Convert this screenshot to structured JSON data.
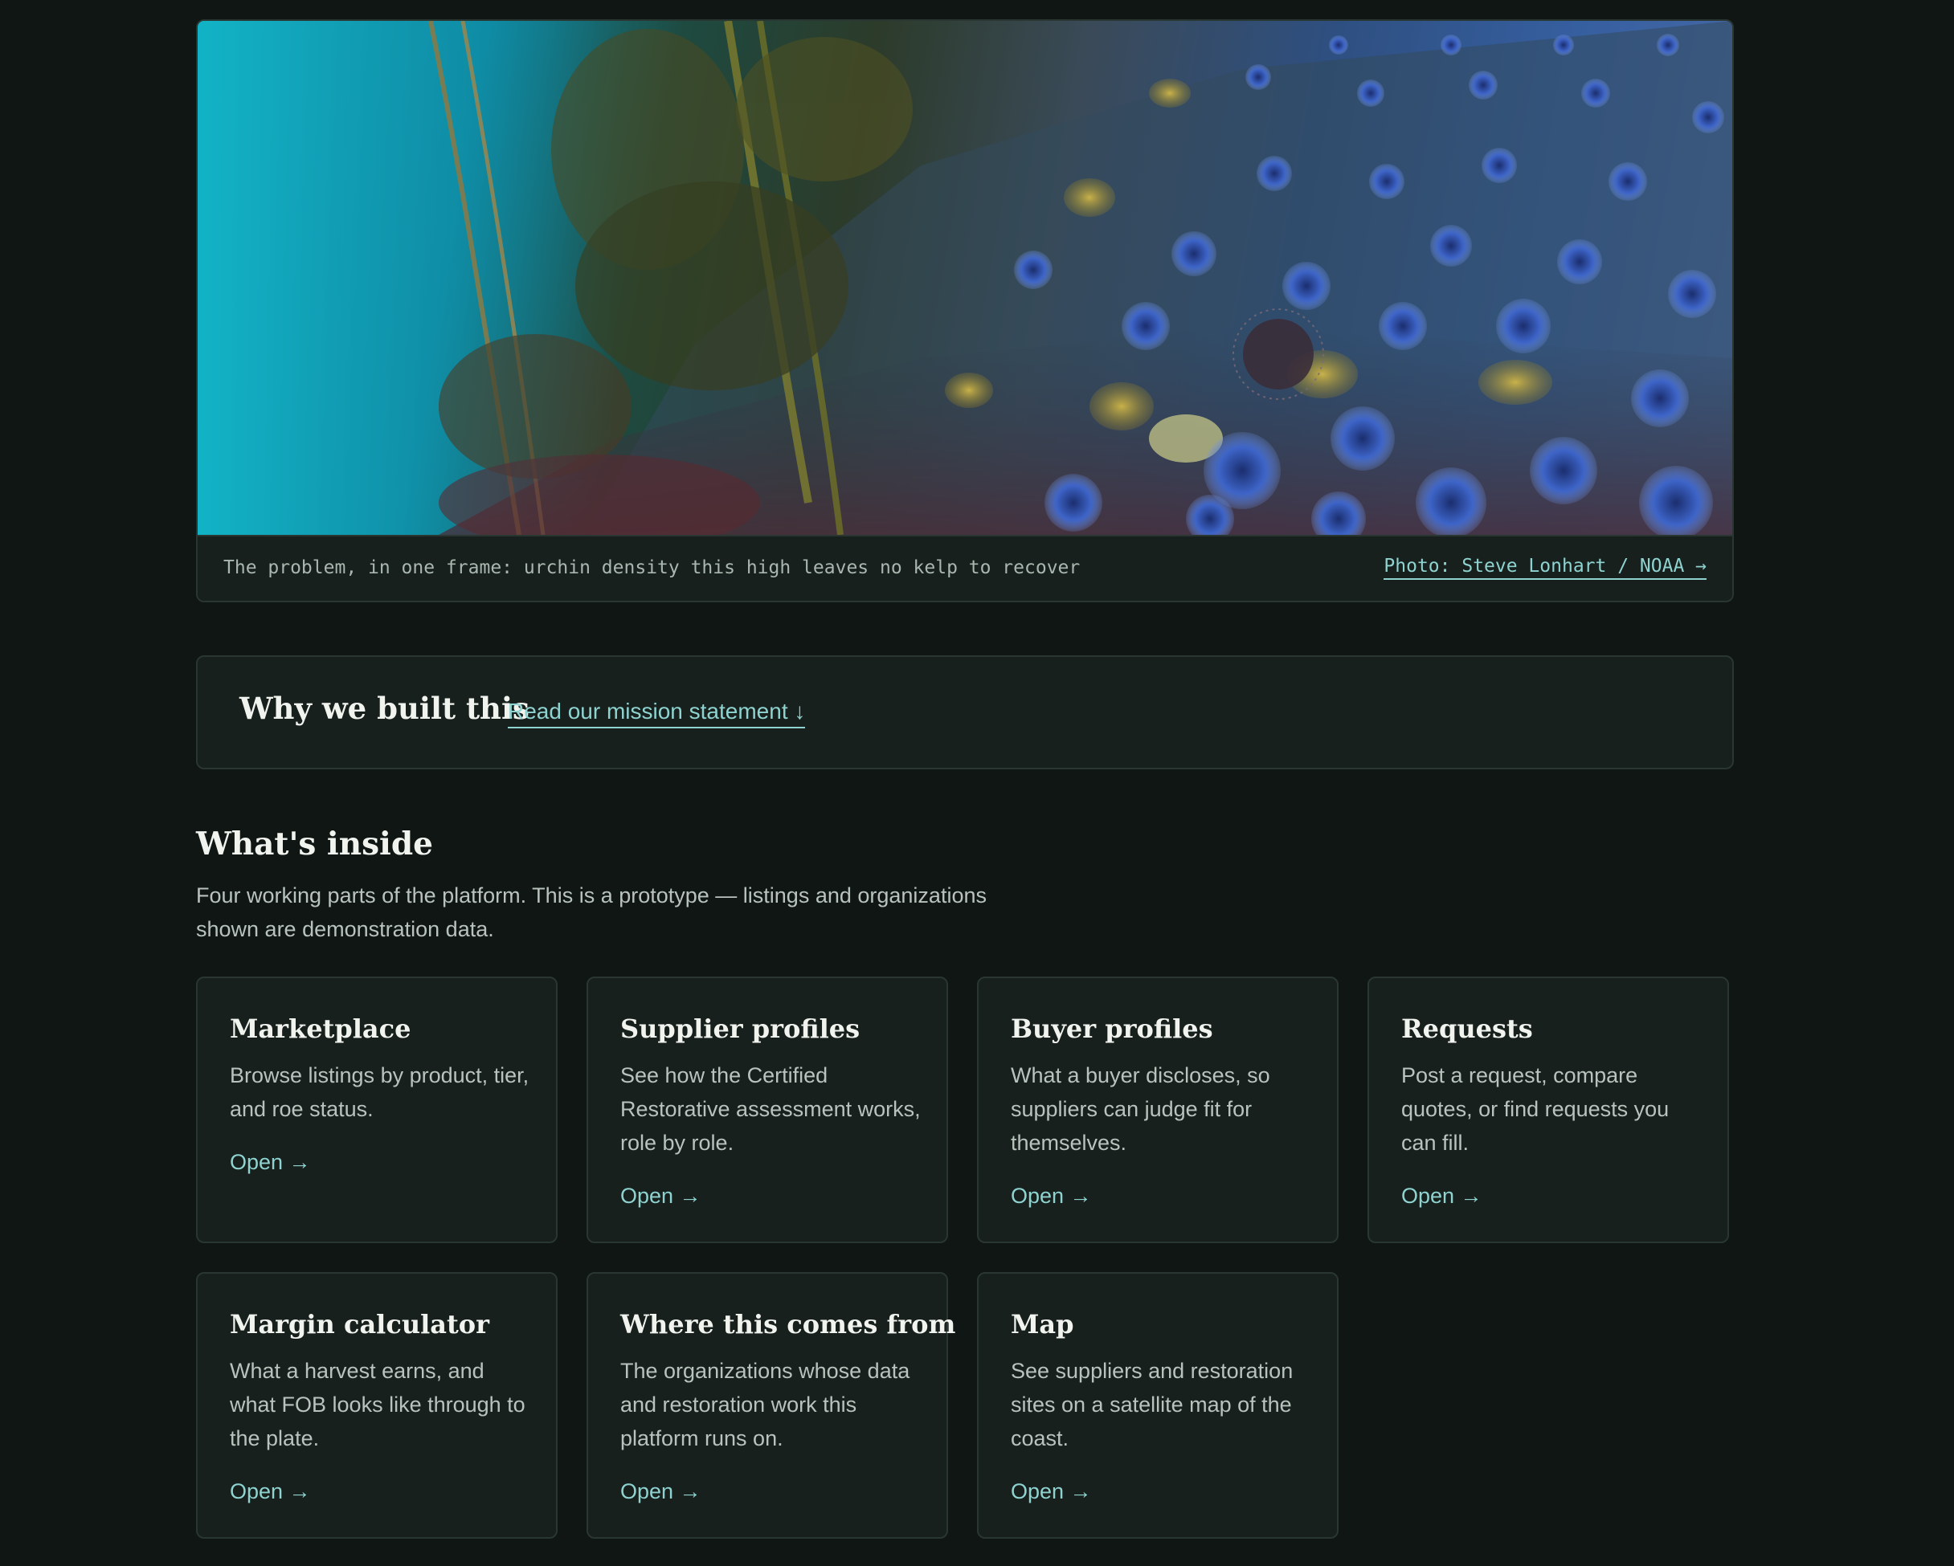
{
  "hero": {
    "caption": "The problem, in one frame: urchin density this high leaves no kelp to recover",
    "credit_label": "Photo: Steve Lonhart / NOAA →"
  },
  "why": {
    "title": "Why we built this",
    "link_label": "Read our mission statement ↓"
  },
  "inside": {
    "title": "What's inside",
    "intro": "Four working parts of the platform. This is a prototype — listings and organizations shown are demonstration data.",
    "cards": [
      {
        "title": "Marketplace",
        "description": "Browse listings by product, tier, and roe status.",
        "link_label": "Open →"
      },
      {
        "title": "Supplier profiles",
        "description": "See how the Certified Restorative assessment works, role by role.",
        "link_label": "Open →"
      },
      {
        "title": "Buyer profiles",
        "description": "What a buyer discloses, so suppliers can judge fit for themselves.",
        "link_label": "Open →"
      },
      {
        "title": "Requests",
        "description": "Post a request, compare quotes, or find requests you can fill.",
        "link_label": "Open →"
      },
      {
        "title": "Margin calculator",
        "description": "What a harvest earns, and what FOB looks like through to the plate.",
        "link_label": "Open →"
      },
      {
        "title": "Where this comes from",
        "description": "The organizations whose data and restoration work this platform runs on.",
        "link_label": "Open →"
      },
      {
        "title": "Map",
        "description": "See suppliers and restoration sites on a satellite map of the coast.",
        "link_label": "Open →"
      }
    ]
  },
  "colors": {
    "background": "#0f1613",
    "panel": "#17201c",
    "border": "#2a3631",
    "accent_link": "#8fd3d1",
    "heading": "#f1f3ef",
    "body_text": "#b9c3be"
  }
}
